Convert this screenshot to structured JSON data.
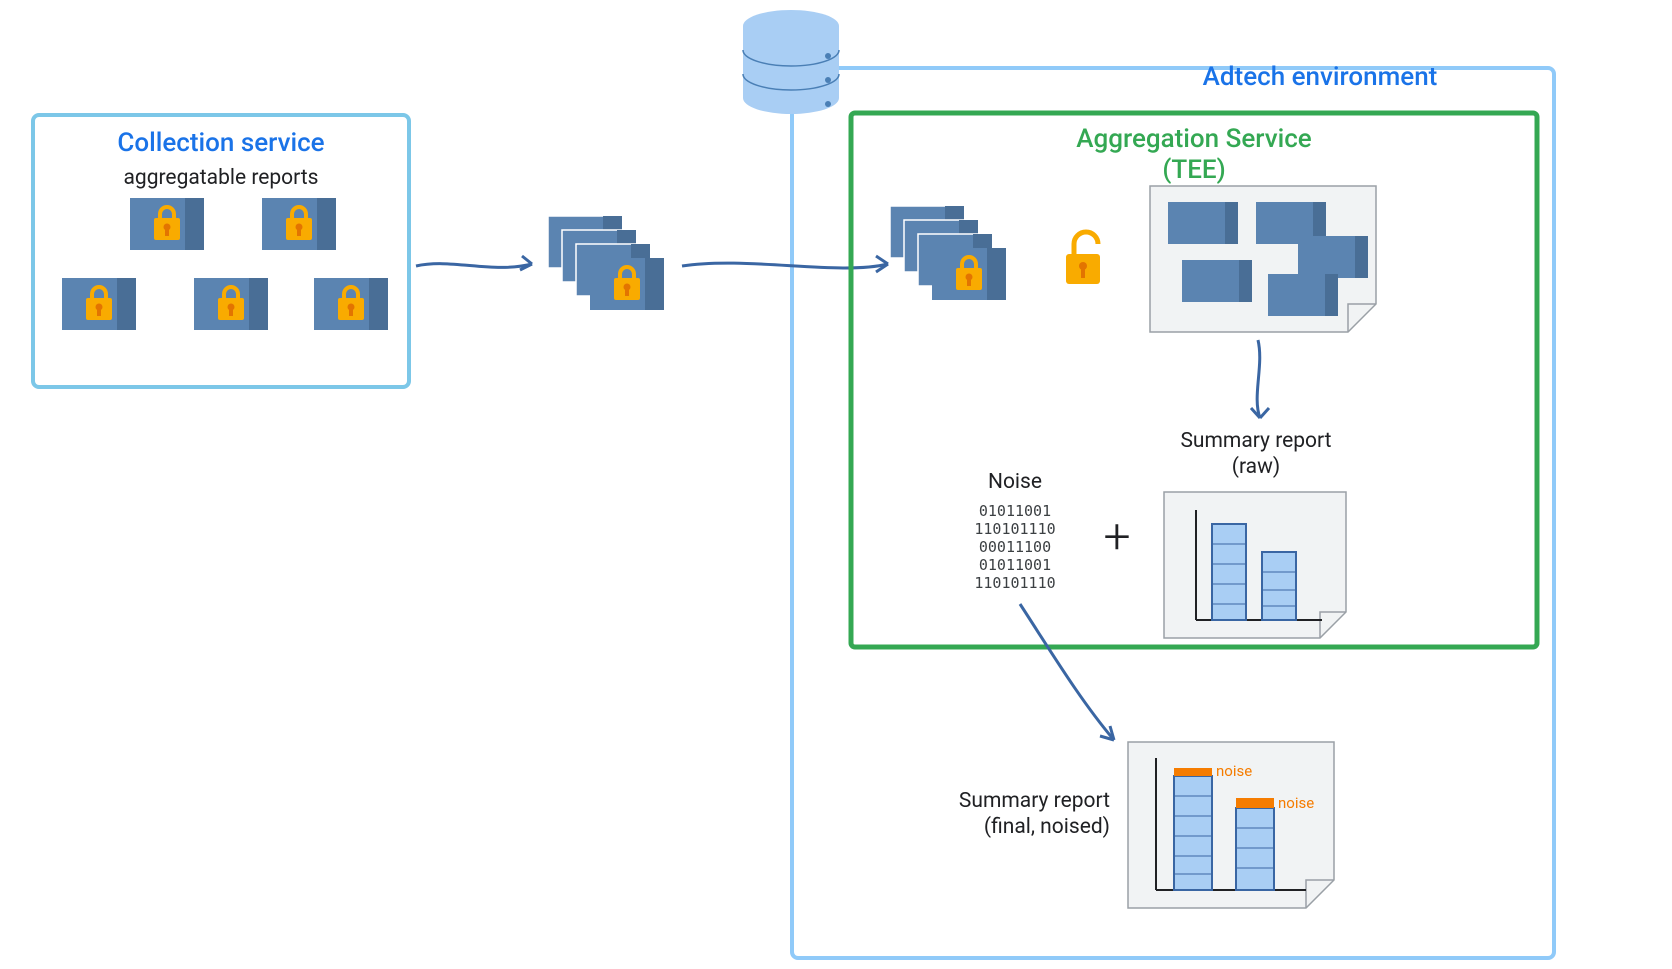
{
  "collection": {
    "title": "Collection service",
    "label": "aggregatable reports"
  },
  "adtech": {
    "title": "Adtech environment"
  },
  "aggregation": {
    "title_line1": "Aggregation Service",
    "title_line2": "(TEE)"
  },
  "noise": {
    "title": "Noise",
    "b1": "01011001",
    "b2": "110101110",
    "b3": "00011100",
    "b4": "01011001",
    "b5": "110101110"
  },
  "summary_raw": {
    "line1": "Summary report",
    "line2": "(raw)"
  },
  "summary_final": {
    "line1": "Summary report",
    "line2": "(final, noised)"
  },
  "plus": "+",
  "noise_tag": "noise"
}
